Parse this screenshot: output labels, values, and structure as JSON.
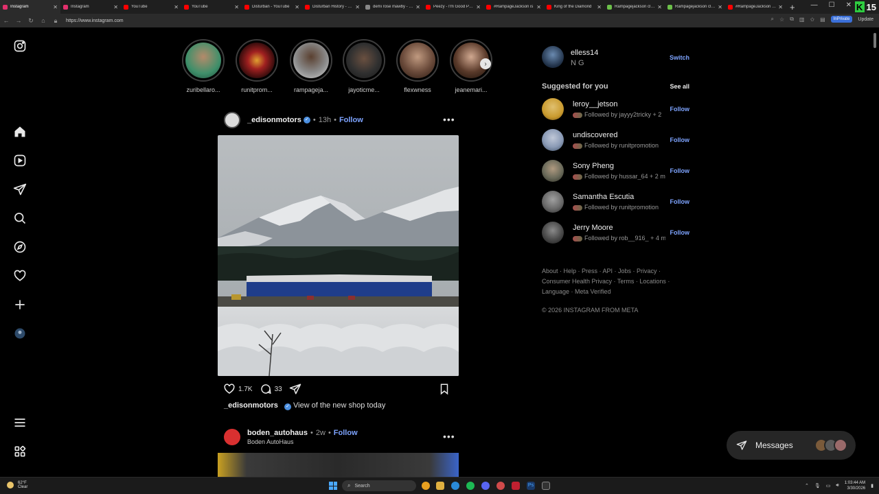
{
  "browser": {
    "tabs": [
      {
        "title": "Instagram",
        "color": "#e1306c",
        "active": true
      },
      {
        "title": "Instagram",
        "color": "#e1306c",
        "active": false
      },
      {
        "title": "YouTube",
        "color": "#ff0000",
        "active": false
      },
      {
        "title": "YouTube",
        "color": "#ff0000",
        "active": false
      },
      {
        "title": "Disturban - YouTube",
        "color": "#ff0000",
        "active": false
      },
      {
        "title": "Disturban History - YouTube",
        "color": "#ff0000",
        "active": false
      },
      {
        "title": "demi rose mawby - Google",
        "color": "#888888",
        "active": false
      },
      {
        "title": "Peezy - I'm Good Pt. 3",
        "color": "#ff0000",
        "active": false
      },
      {
        "title": "#RampageJackson is",
        "color": "#ff0000",
        "active": false
      },
      {
        "title": "King of the Diamond",
        "color": "#ff0000",
        "active": false
      },
      {
        "title": "Rampagejackson clips",
        "color": "#6cc04a",
        "active": false
      },
      {
        "title": "Rampagejackson clips",
        "color": "#6cc04a",
        "active": false
      },
      {
        "title": "#RampageJackson Me",
        "color": "#ff0000",
        "active": false
      }
    ],
    "new_tab": "+",
    "url": "https://www.instagram.com",
    "inprivate": "InPrivate",
    "update": "Update",
    "kick_count": "15"
  },
  "stories": [
    {
      "name": "zuribellaro...",
      "color": "#3f8f6a"
    },
    {
      "name": "runitprom...",
      "color": "#7a1f1f"
    },
    {
      "name": "rampageja...",
      "color": "#9a9a9a"
    },
    {
      "name": "jayoticme...",
      "color": "#444444"
    },
    {
      "name": "flexwness",
      "color": "#8a6d5a"
    },
    {
      "name": "jeanemari...",
      "color": "#6a4a3a"
    }
  ],
  "post1": {
    "username": "_edisonmotors",
    "time": "13h",
    "follow": "Follow",
    "likes": "1.7K",
    "comments": "33",
    "caption": "View of the new shop today"
  },
  "post2": {
    "username": "boden_autohaus",
    "time": "2w",
    "follow": "Follow",
    "subtitle": "Boden AutoHaus"
  },
  "me": {
    "username": "elless14",
    "name": "N G",
    "switch": "Switch"
  },
  "suggested": {
    "title": "Suggested for you",
    "see_all": "See all",
    "items": [
      {
        "username": "leroy__jetson",
        "followed_by": "Followed by jayyy2tricky + 2",
        "follow": "Follow",
        "color": "#c99a2e"
      },
      {
        "username": "undiscovered",
        "followed_by": "Followed by runitpromotion",
        "follow": "Follow",
        "color": "#8a9ab5"
      },
      {
        "username": "Sony Pheng",
        "followed_by": "Followed by hussar_64 + 2 m",
        "follow": "Follow",
        "color": "#6a6a5a"
      },
      {
        "username": "Samantha Escutia",
        "followed_by": "Followed by runitpromotion",
        "follow": "Follow",
        "color": "#7a7a7a"
      },
      {
        "username": "Jerry Moore",
        "followed_by": "Followed by rob__916_ + 4 m",
        "follow": "Follow",
        "color": "#5a5a5a"
      }
    ]
  },
  "footer": {
    "links": "About · Help · Press · API · Jobs · Privacy · Consumer Health Privacy · Terms · Locations · Language · Meta Verified",
    "copyright": "© 2026 INSTAGRAM FROM META"
  },
  "messages": {
    "label": "Messages"
  },
  "taskbar": {
    "temp": "62°F",
    "condition": "Clear",
    "search": "Search",
    "time": "1:03:44 AM",
    "date": "3/30/2026"
  }
}
